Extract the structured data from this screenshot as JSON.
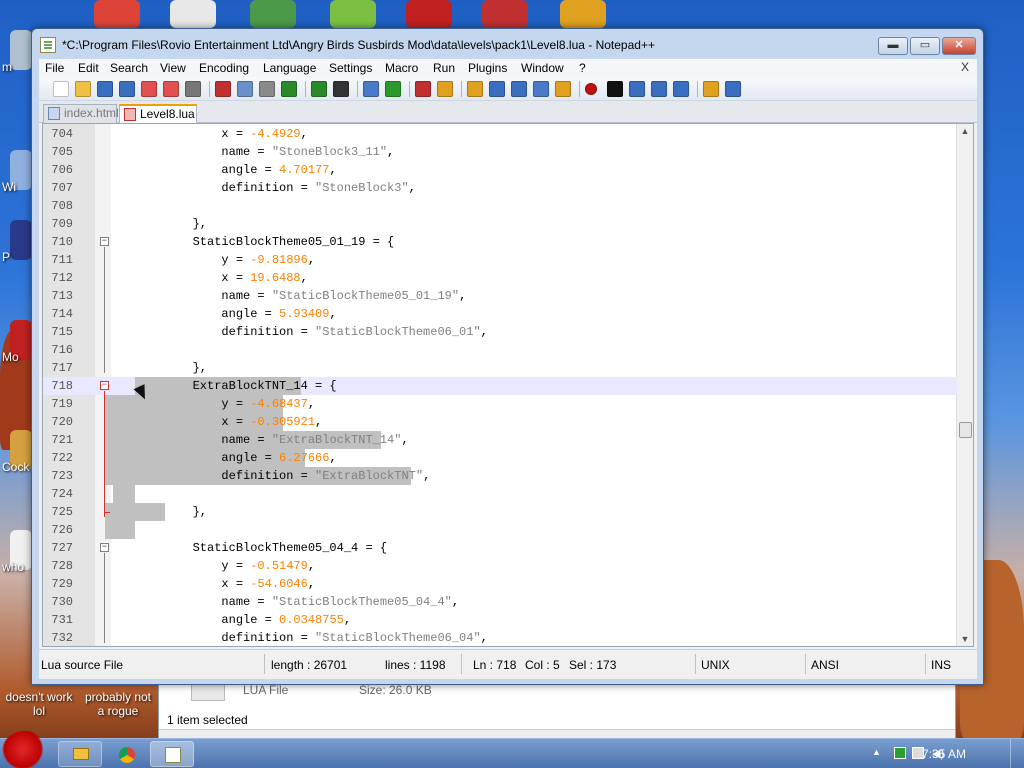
{
  "desktop": {
    "icons": [
      {
        "name": "desktop-icon-1",
        "label": "m",
        "color": "#b0c0d0"
      },
      {
        "name": "desktop-icon-2",
        "label": "Wi",
        "color": "#90b0e0"
      },
      {
        "name": "desktop-icon-3",
        "label": "P",
        "color": "#2a3a8a"
      },
      {
        "name": "desktop-icon-4",
        "label": "Mo",
        "color": "#c02020"
      },
      {
        "name": "desktop-icon-5",
        "label": "Cock",
        "color": "#d4a040"
      },
      {
        "name": "desktop-icon-6",
        "label": "who",
        "color": "#f0f0f0"
      }
    ],
    "bottom_labels": [
      "doesn't work lol",
      "probably not a rogue"
    ],
    "top_icons": [
      {
        "name": "chrome-desktop-icon",
        "color": "#db4437"
      },
      {
        "name": "solitaire-desktop-icon",
        "color": "#e8e8e8"
      },
      {
        "name": "shield-desktop-icon",
        "color": "#4a9a4a"
      },
      {
        "name": "angry-birds-desktop-icon",
        "color": "#7bc043"
      },
      {
        "name": "dev-desktop-icon",
        "color": "#c02020"
      },
      {
        "name": "network-desktop-icon",
        "color": "#c03030"
      },
      {
        "name": "folder-desktop-icon",
        "color": "#e0a020"
      }
    ]
  },
  "explorer": {
    "file_type": "LUA File",
    "file_size": "Size: 26.0 KB",
    "selection": "1 item selected"
  },
  "window": {
    "title": "*C:\\Program Files\\Rovio Entertainment Ltd\\Angry Birds Susbirds Mod\\data\\levels\\pack1\\Level8.lua - Notepad++",
    "minimize": "▬",
    "maximize": "▭",
    "close": "✕"
  },
  "menu": {
    "items": [
      "File",
      "Edit",
      "Search",
      "View",
      "Encoding",
      "Language",
      "Settings",
      "Macro",
      "Run",
      "Plugins",
      "Window",
      "?"
    ],
    "close_x": "X"
  },
  "toolbar": {
    "buttons": [
      "new-file",
      "open-file",
      "save",
      "save-all",
      "close",
      "close-all",
      "print",
      "cut",
      "copy",
      "paste",
      "undo",
      "redo",
      "find",
      "replace",
      "zoom-in",
      "zoom-out",
      "sync-v",
      "sync-h",
      "word-wrap",
      "all-chars",
      "indent-guide",
      "doc-map",
      "record-macro",
      "stop-record",
      "play-macro",
      "run-macro-multiple",
      "save-macro",
      "open-folder",
      "spell-check"
    ]
  },
  "tabs": [
    {
      "label": "index.html",
      "active": false
    },
    {
      "label": "Level8.lua",
      "active": true
    }
  ],
  "editor": {
    "lines": [
      {
        "n": "704",
        "parts": [
          [
            "            x = ",
            ""
          ],
          [
            "-4.4929",
            "num"
          ],
          [
            ",",
            ""
          ]
        ]
      },
      {
        "n": "705",
        "parts": [
          [
            "            name = ",
            ""
          ],
          [
            "\"StoneBlock3_11\"",
            "str"
          ],
          [
            ",",
            ""
          ]
        ]
      },
      {
        "n": "706",
        "parts": [
          [
            "            angle = ",
            ""
          ],
          [
            "4.70177",
            "num"
          ],
          [
            ",",
            ""
          ]
        ]
      },
      {
        "n": "707",
        "parts": [
          [
            "            definition = ",
            ""
          ],
          [
            "\"StoneBlock3\"",
            "str"
          ],
          [
            ",",
            ""
          ]
        ]
      },
      {
        "n": "708",
        "parts": [
          [
            "",
            ""
          ]
        ]
      },
      {
        "n": "709",
        "parts": [
          [
            "        },",
            ""
          ]
        ]
      },
      {
        "n": "710",
        "parts": [
          [
            "        StaticBlockTheme05_01_19 = {",
            ""
          ]
        ],
        "fold": "-"
      },
      {
        "n": "711",
        "parts": [
          [
            "            y = ",
            ""
          ],
          [
            "-9.81896",
            "num"
          ],
          [
            ",",
            ""
          ]
        ]
      },
      {
        "n": "712",
        "parts": [
          [
            "            x = ",
            ""
          ],
          [
            "19.6488",
            "num"
          ],
          [
            ",",
            ""
          ]
        ]
      },
      {
        "n": "713",
        "parts": [
          [
            "            name = ",
            ""
          ],
          [
            "\"StaticBlockTheme05_01_19\"",
            "str"
          ],
          [
            ",",
            ""
          ]
        ]
      },
      {
        "n": "714",
        "parts": [
          [
            "            angle = ",
            ""
          ],
          [
            "5.93409",
            "num"
          ],
          [
            ",",
            ""
          ]
        ]
      },
      {
        "n": "715",
        "parts": [
          [
            "            definition = ",
            ""
          ],
          [
            "\"StaticBlockTheme06_01\"",
            "str"
          ],
          [
            ",",
            ""
          ]
        ]
      },
      {
        "n": "716",
        "parts": [
          [
            "",
            ""
          ]
        ]
      },
      {
        "n": "717",
        "parts": [
          [
            "        },",
            ""
          ]
        ]
      },
      {
        "n": "718",
        "parts": [
          [
            "        ExtraBlockTNT_14 = {",
            ""
          ]
        ],
        "fold": "-",
        "current": true
      },
      {
        "n": "719",
        "parts": [
          [
            "            y = ",
            ""
          ],
          [
            "-4.68437",
            "num"
          ],
          [
            ",",
            ""
          ]
        ]
      },
      {
        "n": "720",
        "parts": [
          [
            "            x = ",
            ""
          ],
          [
            "-0.305921",
            "num"
          ],
          [
            ",",
            ""
          ]
        ]
      },
      {
        "n": "721",
        "parts": [
          [
            "            name = ",
            ""
          ],
          [
            "\"ExtraBlockTNT_14\"",
            "str"
          ],
          [
            ",",
            ""
          ]
        ]
      },
      {
        "n": "722",
        "parts": [
          [
            "            angle = ",
            ""
          ],
          [
            "6.27666",
            "num"
          ],
          [
            ",",
            ""
          ]
        ]
      },
      {
        "n": "723",
        "parts": [
          [
            "            definition = ",
            ""
          ],
          [
            "\"ExtraBlockTNT\"",
            "str"
          ],
          [
            ",",
            ""
          ]
        ]
      },
      {
        "n": "724",
        "parts": [
          [
            "",
            ""
          ]
        ]
      },
      {
        "n": "725",
        "parts": [
          [
            "        },",
            ""
          ]
        ]
      },
      {
        "n": "726",
        "parts": [
          [
            "",
            ""
          ]
        ]
      },
      {
        "n": "727",
        "parts": [
          [
            "        StaticBlockTheme05_04_4 = {",
            ""
          ]
        ],
        "fold": "-"
      },
      {
        "n": "728",
        "parts": [
          [
            "            y = ",
            ""
          ],
          [
            "-0.51479",
            "num"
          ],
          [
            ",",
            ""
          ]
        ]
      },
      {
        "n": "729",
        "parts": [
          [
            "            x = ",
            ""
          ],
          [
            "-54.6046",
            "num"
          ],
          [
            ",",
            ""
          ]
        ]
      },
      {
        "n": "730",
        "parts": [
          [
            "            name = ",
            ""
          ],
          [
            "\"StaticBlockTheme05_04_4\"",
            "str"
          ],
          [
            ",",
            ""
          ]
        ]
      },
      {
        "n": "731",
        "parts": [
          [
            "            angle = ",
            ""
          ],
          [
            "0.0348755",
            "num"
          ],
          [
            ",",
            ""
          ]
        ]
      },
      {
        "n": "732",
        "parts": [
          [
            "            definition = ",
            ""
          ],
          [
            "\"StaticBlockTheme06_04\"",
            "str"
          ],
          [
            ",",
            ""
          ]
        ]
      }
    ]
  },
  "status": {
    "file_type": "Lua source File",
    "length": "length : 26701",
    "lines": "lines : 1198",
    "ln": "Ln : 718",
    "col": "Col : 5",
    "sel": "Sel : 173",
    "eol": "UNIX",
    "encoding": "ANSI",
    "mode": "INS"
  },
  "taskbar": {
    "clock": "7:35 AM"
  },
  "colors": {
    "number": "#ff8000",
    "string": "#808080",
    "selection": "#c0c0c0",
    "current_line": "#e8e8ff"
  }
}
